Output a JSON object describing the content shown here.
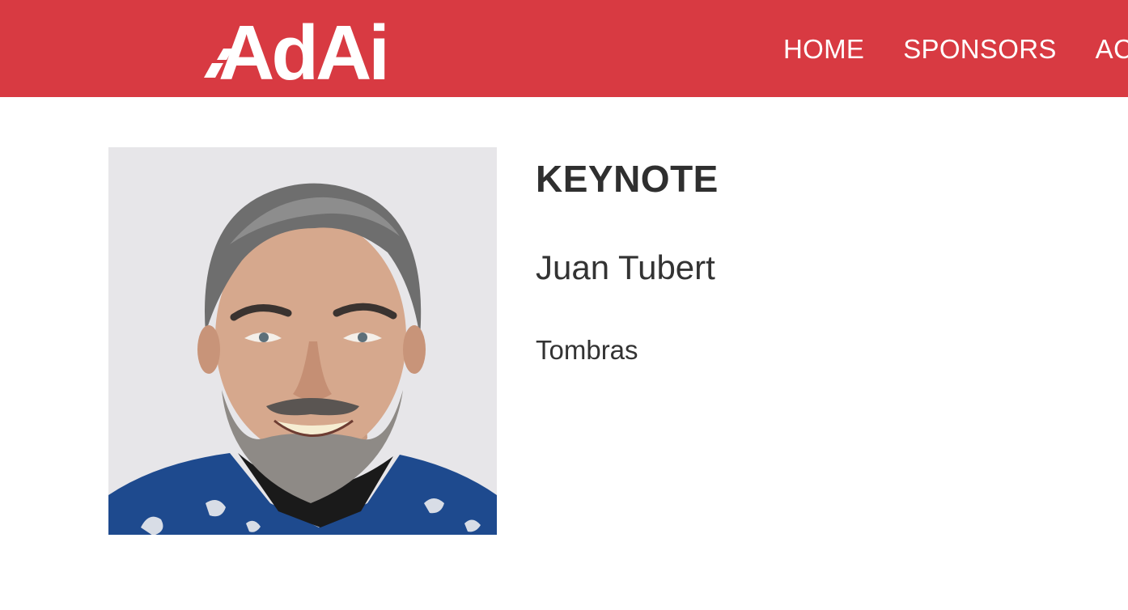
{
  "header": {
    "logo_text": "AdAi",
    "background_color": "#d83a42",
    "nav": [
      {
        "label": "HOME"
      },
      {
        "label": "SPONSORS"
      },
      {
        "label": "AC"
      }
    ]
  },
  "speaker": {
    "role": "KEYNOTE",
    "name": "Juan Tubert",
    "company": "Tombras",
    "photo_icon": "speaker-portrait"
  }
}
